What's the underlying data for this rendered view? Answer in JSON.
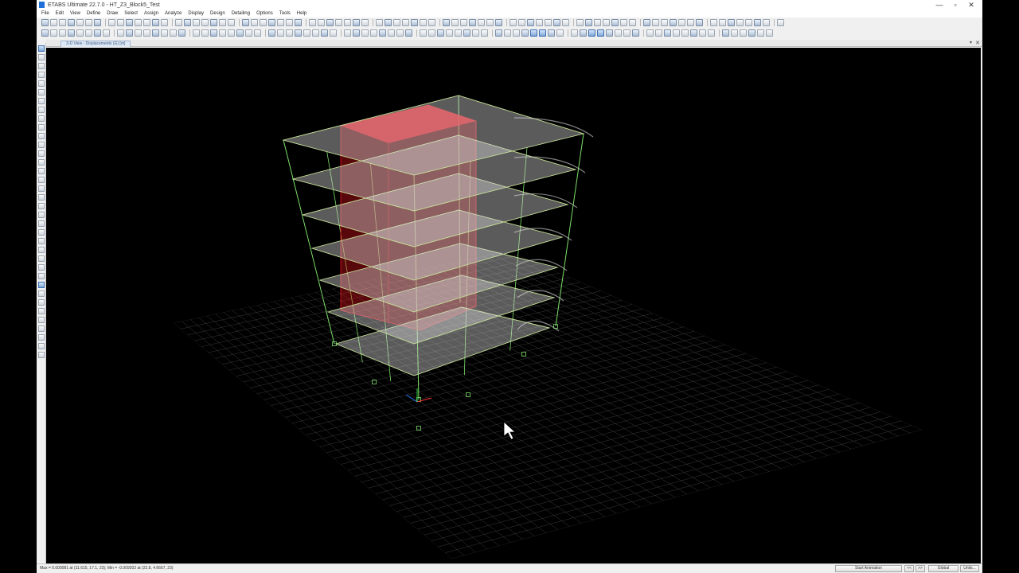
{
  "window": {
    "title": "ETABS Ultimate 22.7.0 - HT_Z3_Block5_Test",
    "controls": {
      "minimize": "—",
      "maximize": "▫",
      "close": "✕"
    }
  },
  "menu": {
    "items": [
      "File",
      "Edit",
      "View",
      "Define",
      "Draw",
      "Select",
      "Assign",
      "Analyze",
      "Display",
      "Design",
      "Detailing",
      "Options",
      "Tools",
      "Help"
    ]
  },
  "view": {
    "tab_label": "3-D View - Displacements (G) [m]",
    "close_glyph": "✕",
    "arrow_glyph": "▾"
  },
  "statusbar": {
    "text": "Max = 0.000081 at (11.615, 17.1, 23);  Min = -0.009202 at (22.8, 4.6667, 23)",
    "animation_button": "Start Animation",
    "prev_button": "<<",
    "next_button": ">>",
    "coord_system": "Global",
    "units_button": "Units..."
  },
  "colors": {
    "background": "#000000",
    "frame_lines": "#7ee06a",
    "slab_fill": "#d8d8d8",
    "slab_edge": "#c8e29a",
    "shear_wall": "#e8141e",
    "ground_grid": "#3a3a3a"
  },
  "icons": {
    "cursor": "arrow-pointer-icon",
    "axis_triad": "axis-triad-icon",
    "support": "pinned-support-icon"
  }
}
